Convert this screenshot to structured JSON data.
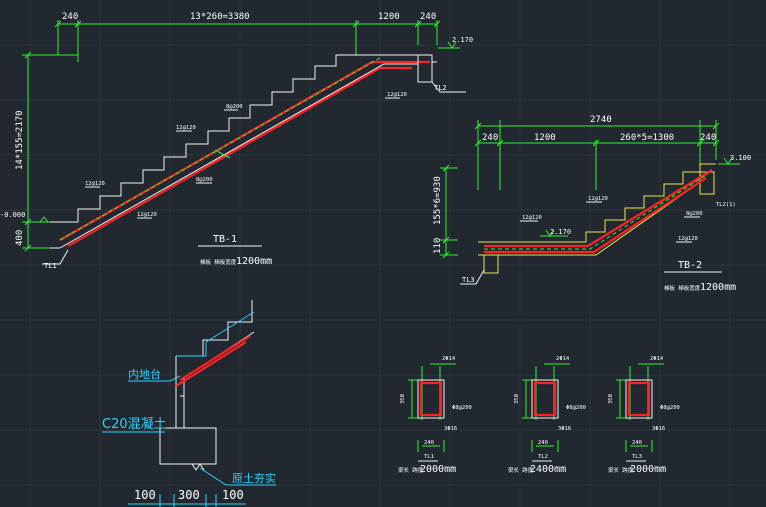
{
  "tb1": {
    "top_dim_left": "240",
    "top_dim_mid": "13*260=3380",
    "top_dim_right1": "1200",
    "top_dim_right2": "240",
    "left_dim_tall": "14*155=2170",
    "left_dim_low": "400",
    "level_top": "2.170",
    "level_bottom": "-0.000",
    "rebar_1": "12@120",
    "rebar_2": "8@200",
    "rebar_3": "12@120",
    "rebar_4": "8@200",
    "rebar_5": "12@120",
    "rebar_6": "12@120",
    "beam_tag_top": "TL2",
    "beam_tag_bottom": "TL1",
    "title": "TB-1",
    "caption_prefix": "梯板 梯板宽度",
    "caption_value": "1200mm"
  },
  "tb2": {
    "top_dim_total": "2740",
    "top_dim_a": "240",
    "top_dim_b": "1200",
    "top_dim_c": "260*5=1300",
    "top_dim_d": "240",
    "left_dim": "155*6=930",
    "left_dim_low": "110",
    "level_top": "3.100",
    "level_mid": "2.170",
    "rebar_1": "12@120",
    "rebar_2": "12@120",
    "rebar_3": "8@200",
    "rebar_4": "12@120",
    "beam_tag_left": "TL3",
    "beam_tag_right": "TL2(1)",
    "title": "TB-2",
    "caption_prefix": "梯板 梯板宽度",
    "caption_value": "1200mm"
  },
  "base": {
    "label_inner": "内地台",
    "label_concrete": "C20混凝土",
    "label_soil": "原土夯实",
    "dim_a": "100",
    "dim_b": "300",
    "dim_c": "100"
  },
  "beams": [
    {
      "top": "2Φ14",
      "height": "350",
      "stirrup": "Φ8@200",
      "bottom": "3Φ16",
      "width": "240",
      "tag": "TL1",
      "caption_prefix": "梁长 跨度",
      "caption_value": "2000mm"
    },
    {
      "top": "2Φ14",
      "height": "350",
      "stirrup": "Φ8@200",
      "bottom": "3Φ16",
      "width": "240",
      "tag": "TL2",
      "caption_prefix": "梁长 跨度",
      "caption_value": "2400mm"
    },
    {
      "top": "2Φ14",
      "height": "350",
      "stirrup": "Φ8@200",
      "bottom": "3Φ16",
      "width": "240",
      "tag": "TL3",
      "caption_prefix": "梁长 跨度",
      "caption_value": "2000mm"
    }
  ],
  "colors": {
    "background": "#212830",
    "dimension": "#31f231",
    "outline": "#f2f2f2",
    "rebar": "#ff2222",
    "annotation": "#2fd3ff",
    "stirrup": "#e8e84a"
  }
}
